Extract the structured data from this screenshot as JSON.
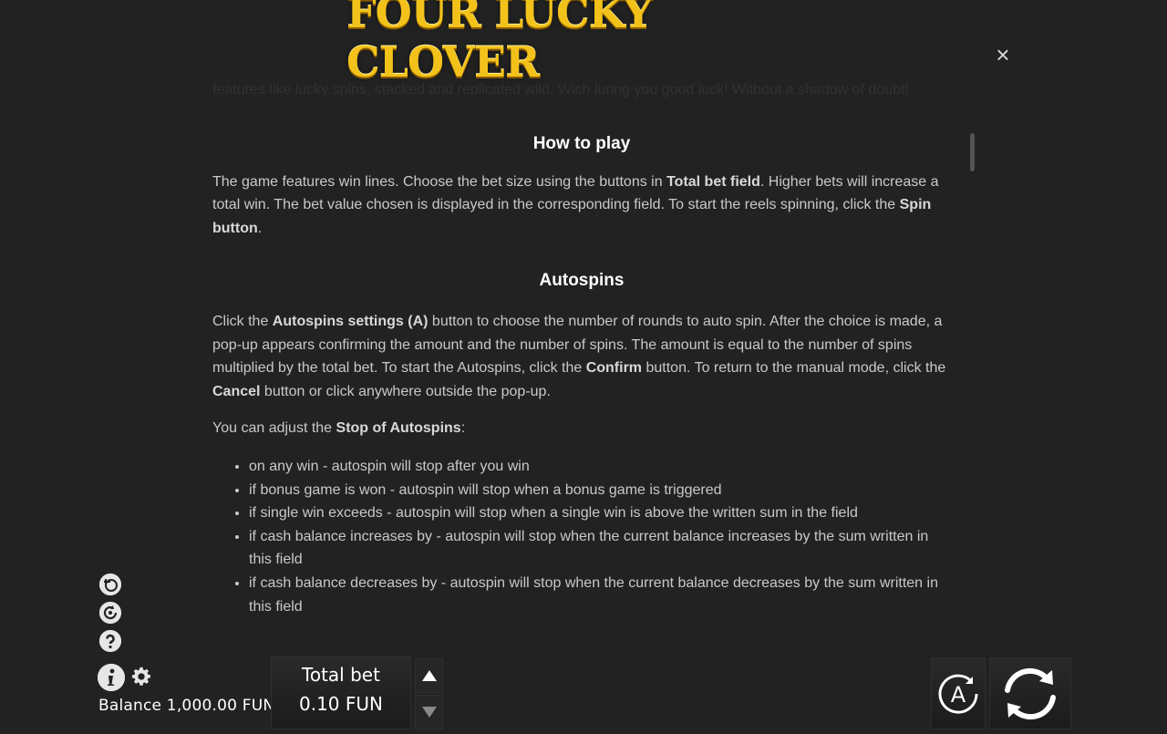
{
  "logo_text": "FOUR LUCKY CLOVER",
  "close_label": "×",
  "faded_text": "features like lucky spins, stacked and replicated wild. Wish luring you good luck! Without a shadow of doubt!",
  "how_to_play": {
    "title": "How to play",
    "p1_a": "The game features win lines. Choose the bet size using the buttons in ",
    "p1_b": "Total bet field",
    "p1_c": ". Higher bets will increase a total win. The bet value chosen is displayed in the corresponding field. To start the reels spinning, click the ",
    "p1_d": "Spin button",
    "p1_e": "."
  },
  "autospins": {
    "title": "Autospins",
    "p1_a": "Click the ",
    "p1_b": "Autospins settings (A)",
    "p1_c": " button to choose the number of rounds to auto spin. After the choice is made, a pop-up appears confirming the amount and the number of spins. The amount is equal to the number of spins multiplied by the total bet. To start the Autospins, click the ",
    "p1_d": "Confirm",
    "p1_e": " button. To return to the manual mode, click the ",
    "p1_f": "Cancel",
    "p1_g": " button or click anywhere outside the pop-up.",
    "p2_a": "You can adjust the ",
    "p2_b": "Stop of Autospins",
    "p2_c": ":",
    "items": [
      "on any win - autospin will stop after you win",
      "if bonus game is won - autospin will stop when a bonus game is triggered",
      "if single win exceeds - autospin will stop when a single win is above the written sum in the field",
      "if cash balance increases by - autospin will stop when the current balance increases by the sum written in this field",
      "if cash balance decreases by - autospin will stop when the current balance decreases by the sum written in this field"
    ]
  },
  "bottom": {
    "balance": "Balance 1,000.00 FUN",
    "total_bet_label": "Total bet",
    "total_bet_value": "0.10 FUN",
    "autospin_letter": "A"
  },
  "icons": {
    "side1": "currency-icon",
    "side2": "history-icon",
    "side3": "help-icon",
    "info": "info-icon",
    "settings": "gear-icon"
  },
  "colors": {
    "background": "#222222",
    "text": "#c9c9c9",
    "heading": "#ffffff",
    "logo_gold": "#f3c21a"
  }
}
